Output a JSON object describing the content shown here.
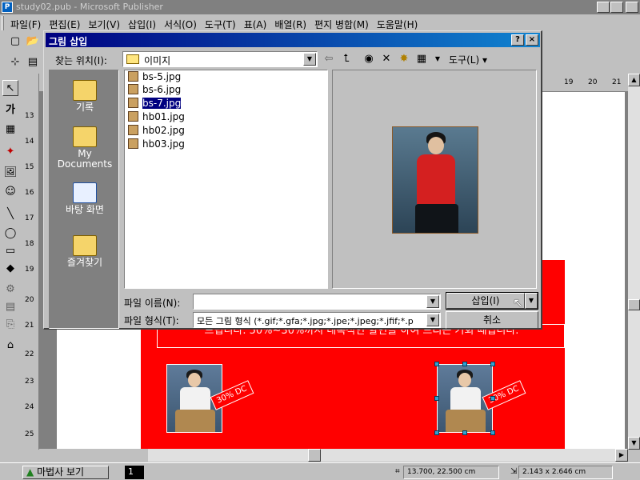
{
  "app": {
    "title": "study02.pub - Microsoft Publisher",
    "icon_label": "P",
    "window_buttons": [
      "_",
      "▫",
      "×"
    ]
  },
  "menu": {
    "items": [
      "파일(F)",
      "편집(E)",
      "보기(V)",
      "삽입(I)",
      "서식(O)",
      "도구(T)",
      "표(A)",
      "배열(R)",
      "편지 병합(M)",
      "도움말(H)"
    ]
  },
  "toolbar": {
    "icons": [
      "new-document-icon",
      "open-folder-icon",
      "snap-icon",
      "connect-frame-icon"
    ],
    "icon_glyphs": [
      "▢",
      "📂",
      "⊹",
      "▤"
    ]
  },
  "left_tools": {
    "icons": [
      "pointer-icon",
      "text-tool-icon",
      "table-tool-icon",
      "wordart-icon",
      "picture-tool-icon",
      "clipart-icon",
      "line-icon",
      "oval-icon",
      "rectangle-icon",
      "custom-shape-icon",
      "design-gallery-icon",
      "form-control-icon",
      "html-code-icon",
      "object-icon"
    ],
    "glyphs": [
      "↖",
      "가",
      "▦",
      "✦",
      "🖼",
      "☺",
      "╲",
      "◯",
      "▭",
      "◆",
      "⚙",
      "▤",
      "⎘",
      "⌂"
    ]
  },
  "vruler": {
    "numbers": [
      "13",
      "14",
      "15",
      "16",
      "17",
      "18",
      "19",
      "20",
      "21",
      "22",
      "23",
      "24",
      "25"
    ]
  },
  "hruler": {
    "numbers": [
      "18",
      "19",
      "20",
      "21"
    ]
  },
  "document": {
    "banner_text": "드립니다. 50%~30%까지 대폭적인 할인을 하여 드리는 기회 때입니다.",
    "dc_label": "30% DC"
  },
  "statusbar": {
    "wizard_label": "마법사 보기",
    "page_number": "1",
    "position": "13.700, 22.500 cm",
    "size": "2.143 x  2.646 cm"
  },
  "dialog": {
    "title": "그림 삽입",
    "help_button": "?",
    "close_button": "×",
    "lookin_label": "찾는 위치(I):",
    "lookin_value": "이미지",
    "tools_label": "도구(L) ▾",
    "places": [
      {
        "name": "history",
        "label": "기록"
      },
      {
        "name": "my-documents",
        "label": "My Documents"
      },
      {
        "name": "desktop",
        "label": "바탕 화면"
      },
      {
        "name": "favorites",
        "label": "즐겨찾기"
      }
    ],
    "files": [
      {
        "name": "bs-5.jpg",
        "selected": false
      },
      {
        "name": "bs-6.jpg",
        "selected": false
      },
      {
        "name": "bs-7.jpg",
        "selected": true
      },
      {
        "name": "hb01.jpg",
        "selected": false
      },
      {
        "name": "hb02.jpg",
        "selected": false
      },
      {
        "name": "hb03.jpg",
        "selected": false
      }
    ],
    "filename_label": "파일 이름(N):",
    "filename_value": "",
    "filetype_label": "파일 형식(T):",
    "filetype_value": "모든 그림 형식 (*.gif;*.gfa;*.jpg;*.jpe;*.jpeg;*.jfif;*.p",
    "insert_label": "삽입(I)",
    "cancel_label": "취소"
  }
}
